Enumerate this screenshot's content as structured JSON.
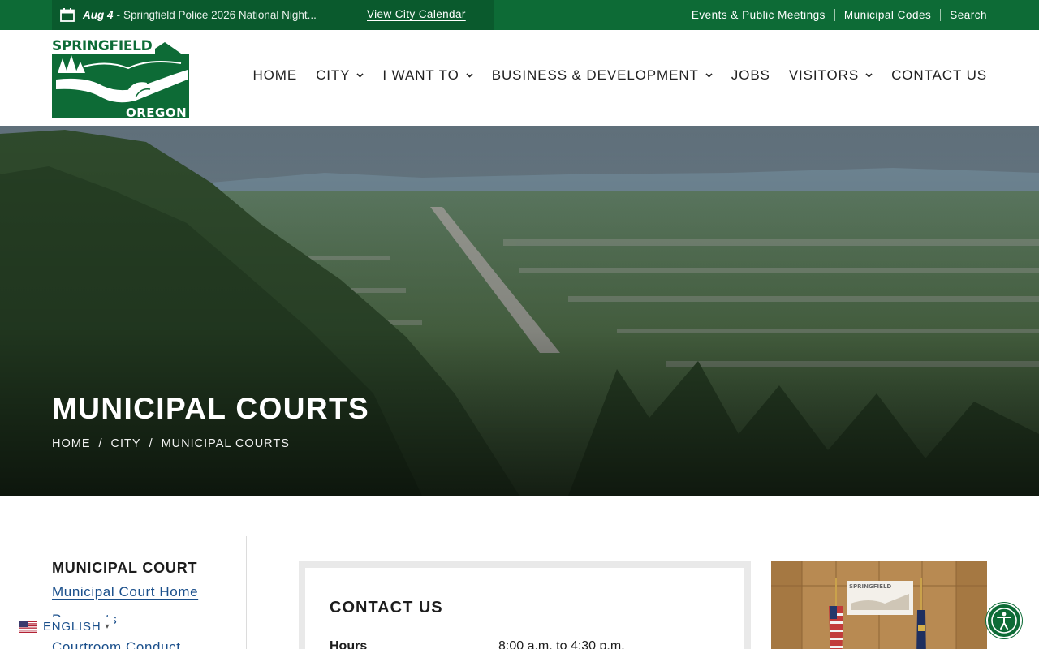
{
  "announcement": {
    "date": "Aug 4",
    "separator": "-",
    "title": "Springfield Police 2026 National Night...",
    "link_label": "View City Calendar"
  },
  "utility_links": [
    "Events & Public Meetings",
    "Municipal Codes",
    "Search"
  ],
  "logo": {
    "word_top": "SPRINGFIELD",
    "word_bottom": "OREGON"
  },
  "nav": [
    {
      "label": "HOME",
      "dropdown": false
    },
    {
      "label": "CITY",
      "dropdown": true
    },
    {
      "label": "I WANT TO",
      "dropdown": true
    },
    {
      "label": "BUSINESS & DEVELOPMENT",
      "dropdown": true
    },
    {
      "label": "JOBS",
      "dropdown": false
    },
    {
      "label": "VISITORS",
      "dropdown": true
    },
    {
      "label": "CONTACT US",
      "dropdown": false
    }
  ],
  "hero": {
    "title": "MUNICIPAL COURTS",
    "breadcrumb": [
      "HOME",
      "CITY",
      "MUNICIPAL COURTS"
    ]
  },
  "sidebar": {
    "title": "MUNICIPAL COURT",
    "links": [
      "Municipal Court Home",
      "Payments",
      "Courtroom Conduct"
    ]
  },
  "contact": {
    "title": "CONTACT US",
    "hours_label": "Hours",
    "hours_value": "8:00 a.m. to 4:30 p.m."
  },
  "language": {
    "label": "ENGLISH",
    "caret": "▾"
  },
  "colors": {
    "brand_green": "#0d6b36",
    "link_blue": "#1a4f8b"
  }
}
